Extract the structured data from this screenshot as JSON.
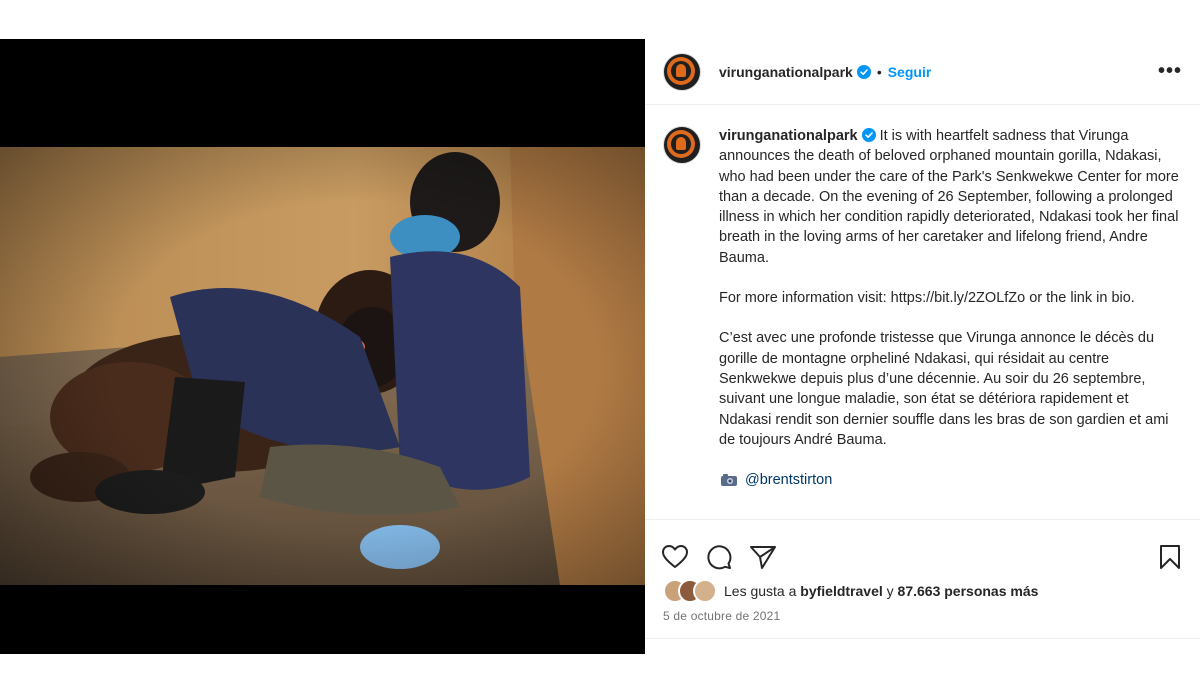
{
  "account": {
    "username": "virunganationalpark",
    "follow_label": "Seguir",
    "separator": "•",
    "more_label": "•••"
  },
  "caption": {
    "username": "virunganationalpark",
    "paragraph_1": "It is with heartfelt sadness that Virunga announces the death of beloved orphaned mountain gorilla, Ndakasi, who had been under the care of the Park's Senkwekwe Center for more than a decade. On the evening of 26 September, following a prolonged illness in which her condition rapidly deteriorated, Ndakasi took her final breath in the loving arms of her caretaker and lifelong friend, Andre Bauma.",
    "paragraph_2": "For more information visit: https://bit.ly/2ZOLfZo or the link in bio.",
    "paragraph_3": "C’est avec une profonde tristesse que Virunga annonce le décès du gorille de montagne orpheliné Ndakasi, qui résidait au centre Senkwekwe depuis plus d’une décennie. Au soir du 26 septembre, suivant une longue maladie, son état se détériora rapidement et Ndakasi rendit son dernier souffle dans les bras de son gardien et ami de toujours André Bauma.",
    "photo_credit": "@brentstirton"
  },
  "likes": {
    "prefix": "Les gusta a",
    "first_user": "byfieldtravel",
    "connector": "y",
    "others": "87.663 personas más"
  },
  "date": "5 de octubre de 2021",
  "icons": {
    "like": "heart-icon",
    "comment": "comment-icon",
    "share": "share-icon",
    "save": "bookmark-icon",
    "verified": "verified-badge-icon",
    "camera": "camera-icon"
  },
  "colors": {
    "accent": "#0095f6",
    "brand_orange": "#e06a1b",
    "text": "#262626",
    "muted": "#737373"
  }
}
